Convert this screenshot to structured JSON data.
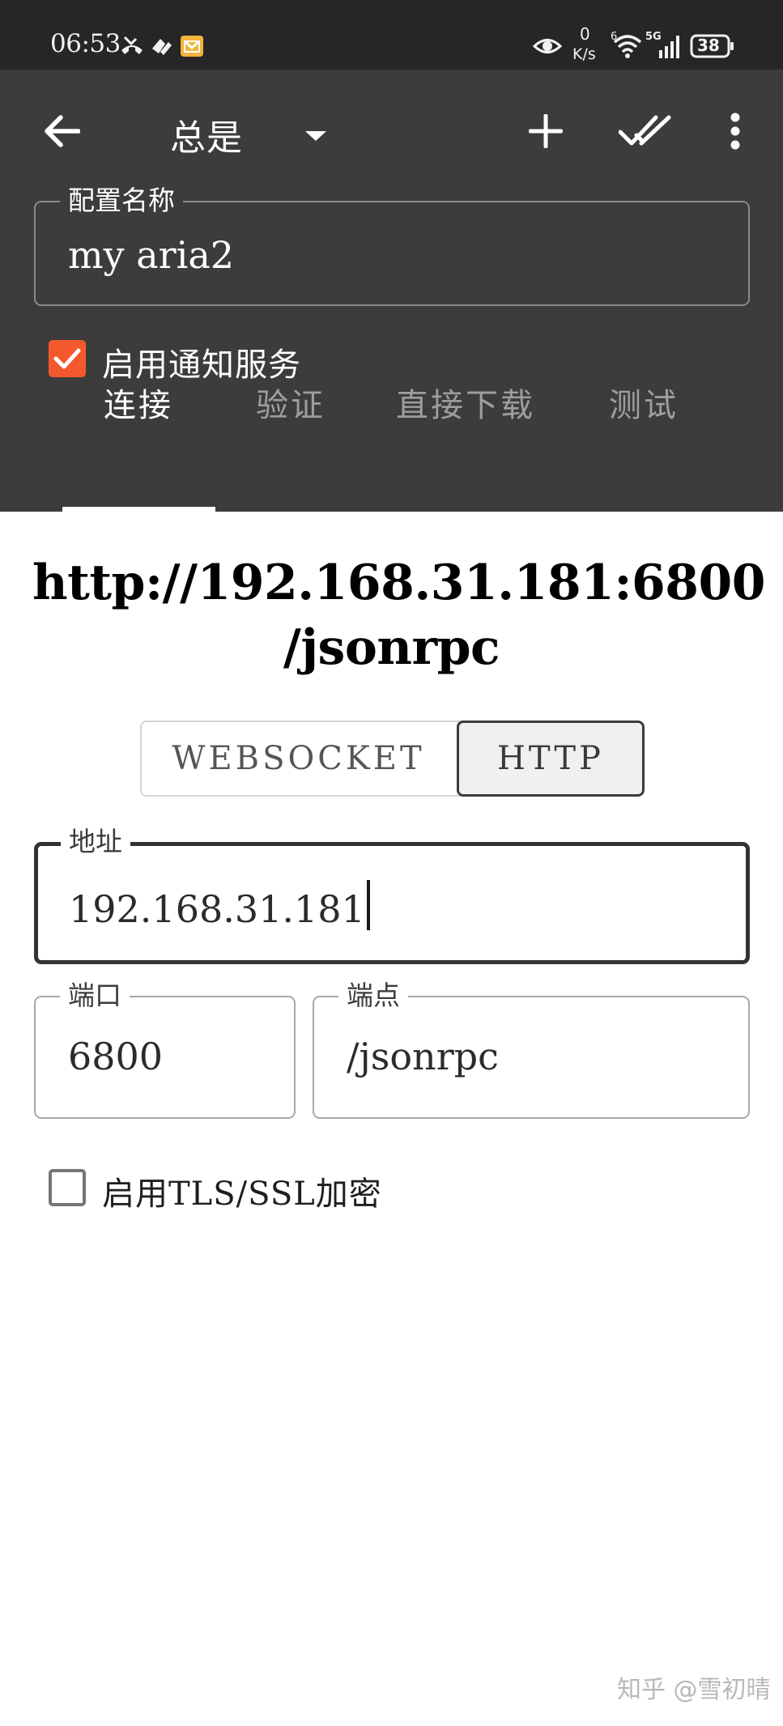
{
  "status_bar": {
    "time": "06:53",
    "network_speed_value": "0",
    "network_speed_unit": "K/s",
    "signal_label": "5G",
    "wifi_label": "6",
    "battery": "38",
    "icons": [
      "missed-call-icon",
      "app-icon",
      "message-icon",
      "eye-icon",
      "wifi-icon",
      "signal-icon",
      "battery-icon"
    ]
  },
  "toolbar": {
    "back_icon": "back-arrow-icon",
    "filter_value": "总是",
    "add_icon": "plus-icon",
    "done_all_icon": "done-all-icon",
    "more_icon": "more-vert-icon"
  },
  "profile": {
    "name_label": "配置名称",
    "name_value": "my aria2",
    "notification_label": "启用通知服务",
    "notification_checked": true
  },
  "tabs": [
    {
      "label": "连接",
      "active": true
    },
    {
      "label": "验证",
      "active": false
    },
    {
      "label": "直接下载",
      "active": false
    },
    {
      "label": "测试",
      "active": false
    }
  ],
  "connection": {
    "url_line1": "http://192.168.31.181:6800",
    "url_line2": "/jsonrpc",
    "transport_options": [
      "WEBSOCKET",
      "HTTP"
    ],
    "transport_selected": "HTTP",
    "address_label": "地址",
    "address_value": "192.168.31.181",
    "port_label": "端口",
    "port_value": "6800",
    "endpoint_label": "端点",
    "endpoint_value": "/jsonrpc",
    "tls_label": "启用TLS/SSL加密",
    "tls_checked": false
  },
  "watermark": "知乎 @雪初晴",
  "colors": {
    "header_bg": "#3c3c3c",
    "status_bg": "#262626",
    "accent": "#f4592e"
  }
}
